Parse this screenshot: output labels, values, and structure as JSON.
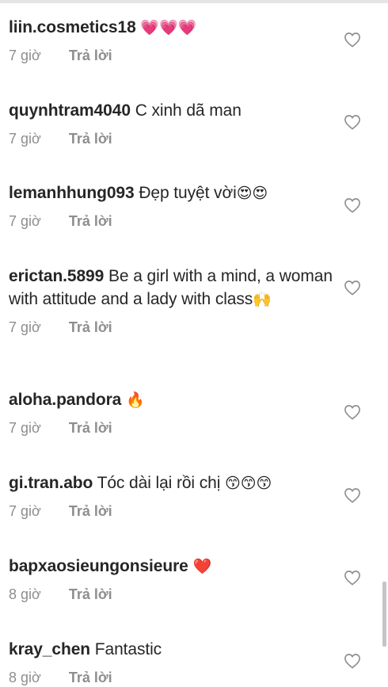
{
  "comments": [
    {
      "user": "liin.cosmetics18",
      "text": "",
      "emoji": "💗💗💗",
      "time": "7 giờ",
      "reply": "Trả lời"
    },
    {
      "user": "quynhtram4040",
      "text": "C xinh dã man",
      "emoji": "",
      "time": "7 giờ",
      "reply": "Trả lời"
    },
    {
      "user": "lemanhhung093",
      "text": "Đẹp tuyệt vời",
      "emoji": "😍😍",
      "time": "7 giờ",
      "reply": "Trả lời"
    },
    {
      "user": "erictan.5899",
      "text": "Be a girl with a mind, a woman with attitude and a lady with class",
      "emoji": "🙌",
      "time": "7 giờ",
      "reply": "Trả lời"
    },
    {
      "user": "aloha.pandora",
      "text": "",
      "emoji": "🔥",
      "time": "7 giờ",
      "reply": "Trả lời"
    },
    {
      "user": "gi.tran.abo",
      "text": "Tóc dài lại rồi chị",
      "emoji": "😙😙😙",
      "time": "7 giờ",
      "reply": "Trả lời"
    },
    {
      "user": "bapxaosieungonsieure",
      "text": "",
      "emoji": "❤️",
      "time": "8 giờ",
      "reply": "Trả lời"
    },
    {
      "user": "kray_chen",
      "text": "Fantastic",
      "emoji": "",
      "time": "8 giờ",
      "reply": "Trả lời"
    }
  ],
  "icons": {
    "like": "heart-outline-icon"
  },
  "colors": {
    "text": "#262626",
    "meta": "#8e8e8e",
    "heart_outline": "#8e8e8e"
  }
}
